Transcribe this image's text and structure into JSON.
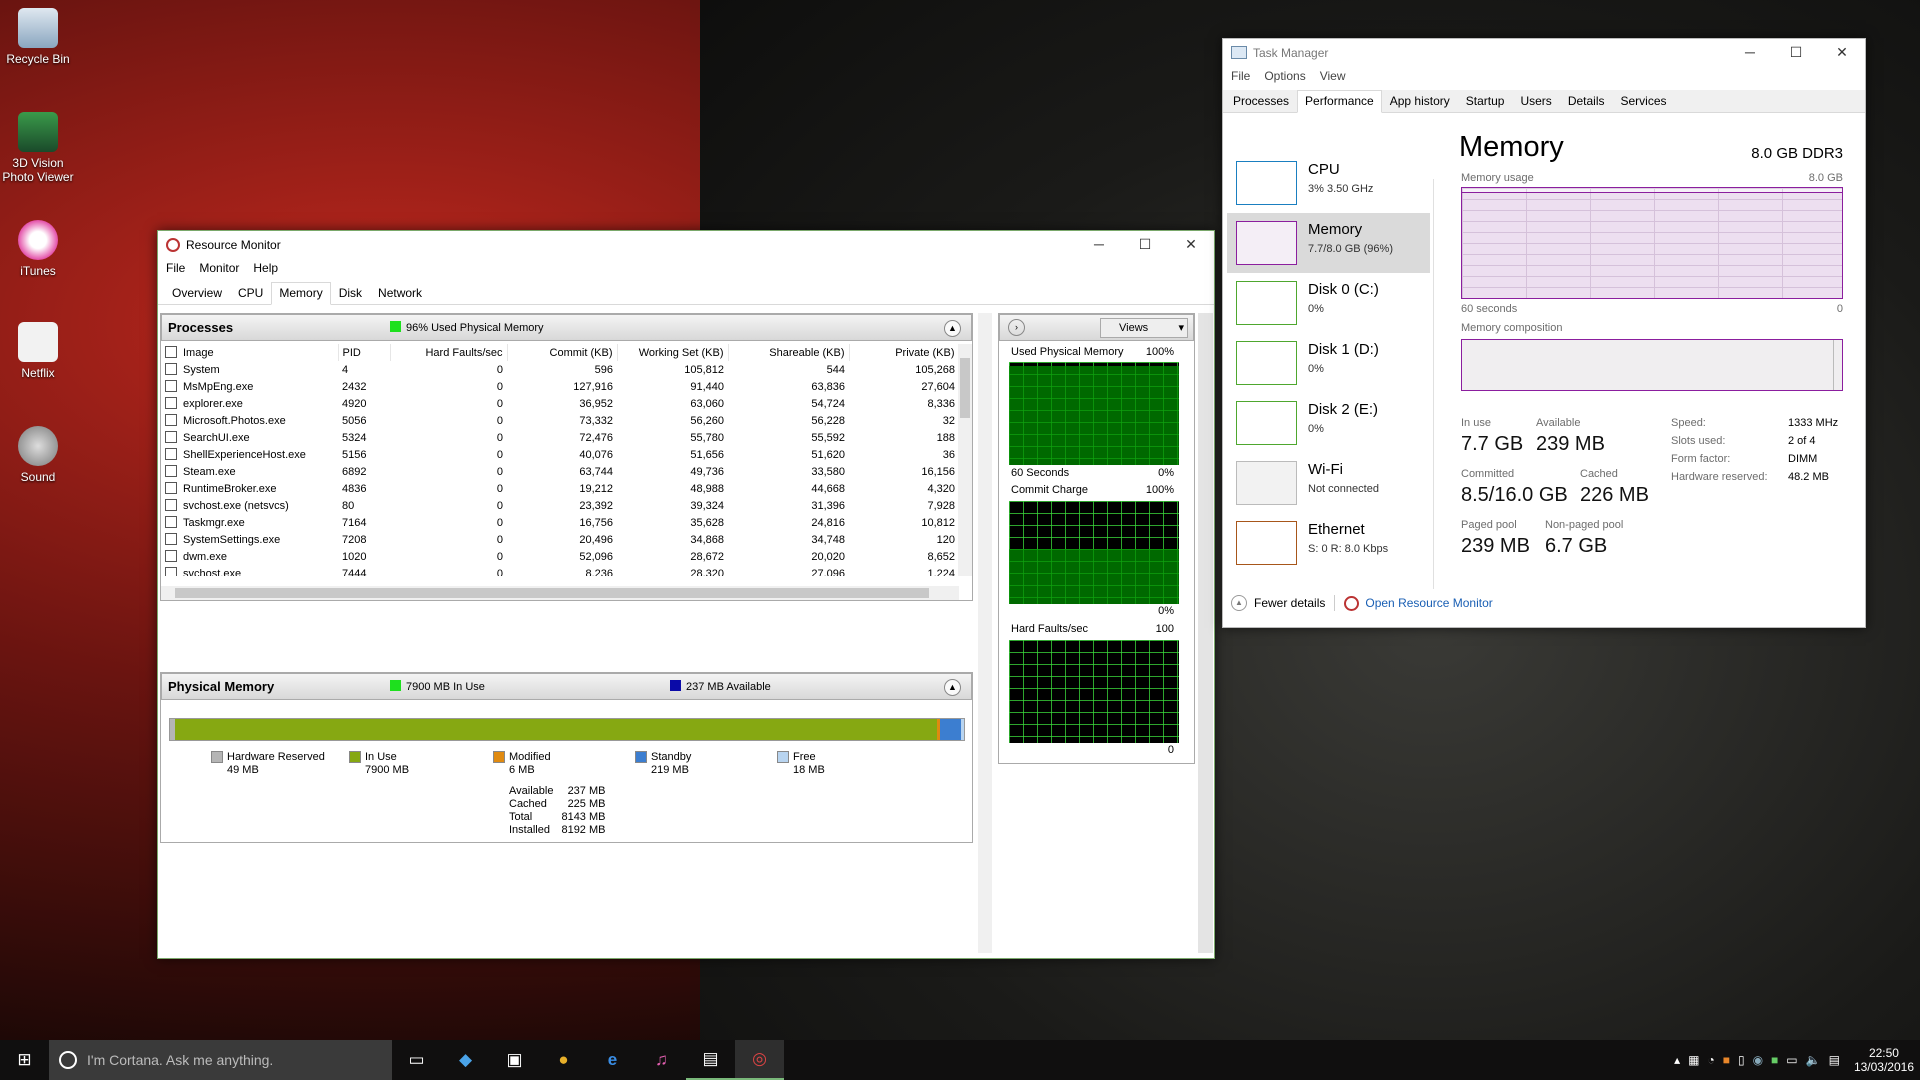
{
  "desktop": {
    "icons": [
      {
        "label": "Recycle Bin",
        "name": "recycle-bin-icon"
      },
      {
        "label": "3D Vision Photo Viewer",
        "name": "3d-vision-icon"
      },
      {
        "label": "iTunes",
        "name": "itunes-icon"
      },
      {
        "label": "Netflix",
        "name": "netflix-icon"
      },
      {
        "label": "Sound",
        "name": "sound-icon"
      }
    ]
  },
  "resmon": {
    "title": "Resource Monitor",
    "menu": [
      "File",
      "Monitor",
      "Help"
    ],
    "tabs": [
      "Overview",
      "CPU",
      "Memory",
      "Disk",
      "Network"
    ],
    "active_tab": "Memory",
    "processes": {
      "title": "Processes",
      "legend": "96% Used Physical Memory",
      "legend_color": "#1ee01e",
      "columns": [
        "Image",
        "PID",
        "Hard Faults/sec",
        "Commit (KB)",
        "Working Set (KB)",
        "Shareable (KB)",
        "Private (KB)"
      ],
      "rows": [
        [
          "System",
          "4",
          "0",
          "596",
          "105,812",
          "544",
          "105,268"
        ],
        [
          "MsMpEng.exe",
          "2432",
          "0",
          "127,916",
          "91,440",
          "63,836",
          "27,604"
        ],
        [
          "explorer.exe",
          "4920",
          "0",
          "36,952",
          "63,060",
          "54,724",
          "8,336"
        ],
        [
          "Microsoft.Photos.exe",
          "5056",
          "0",
          "73,332",
          "56,260",
          "56,228",
          "32"
        ],
        [
          "SearchUI.exe",
          "5324",
          "0",
          "72,476",
          "55,780",
          "55,592",
          "188"
        ],
        [
          "ShellExperienceHost.exe",
          "5156",
          "0",
          "40,076",
          "51,656",
          "51,620",
          "36"
        ],
        [
          "Steam.exe",
          "6892",
          "0",
          "63,744",
          "49,736",
          "33,580",
          "16,156"
        ],
        [
          "RuntimeBroker.exe",
          "4836",
          "0",
          "19,212",
          "48,988",
          "44,668",
          "4,320"
        ],
        [
          "svchost.exe (netsvcs)",
          "80",
          "0",
          "23,392",
          "39,324",
          "31,396",
          "7,928"
        ],
        [
          "Taskmgr.exe",
          "7164",
          "0",
          "16,756",
          "35,628",
          "24,816",
          "10,812"
        ],
        [
          "SystemSettings.exe",
          "7208",
          "0",
          "20,496",
          "34,868",
          "34,748",
          "120"
        ],
        [
          "dwm.exe",
          "1020",
          "0",
          "52,096",
          "28,672",
          "20,020",
          "8,652"
        ],
        [
          "svchost.exe",
          "7444",
          "0",
          "8,236",
          "28,320",
          "27,096",
          "1,224"
        ],
        [
          "perfmon.exe",
          "7400",
          "0",
          "15,408",
          "27,900",
          "14,264",
          "13,636"
        ],
        [
          "SearchIndexer.exe",
          "5124",
          "0",
          "34,628",
          "27,512",
          "20,708",
          "6,804"
        ],
        [
          "steamwebhelper.exe",
          "6320",
          "0",
          "11,440",
          "24,768",
          "24,080",
          "688"
        ],
        [
          "steamwebhelper.exe",
          "7040",
          "0",
          "26,796",
          "24,388",
          "23,860",
          "528"
        ]
      ]
    },
    "physical": {
      "title": "Physical Memory",
      "in_use_legend": "7900 MB In Use",
      "in_use_color": "#1ee01e",
      "available_legend": "237 MB Available",
      "available_color": "#0a0aa8",
      "bar": [
        {
          "label": "Hardware Reserved",
          "value": "49 MB",
          "mb": 49,
          "color": "#b5b5b5"
        },
        {
          "label": "In Use",
          "value": "7900 MB",
          "mb": 7900,
          "color": "#86a812"
        },
        {
          "label": "Modified",
          "value": "6 MB",
          "mb": 6,
          "color": "#e08a10"
        },
        {
          "label": "Standby",
          "value": "219 MB",
          "mb": 219,
          "color": "#3c7ed0"
        },
        {
          "label": "Free",
          "value": "18 MB",
          "mb": 18,
          "color": "#b8d4f0"
        }
      ],
      "stats": [
        [
          "Available",
          "237 MB"
        ],
        [
          "Cached",
          "225 MB"
        ],
        [
          "Total",
          "8143 MB"
        ],
        [
          "Installed",
          "8192 MB"
        ]
      ]
    },
    "graphs": {
      "views_label": "Views",
      "items": [
        {
          "title": "Used Physical Memory",
          "max": "100%",
          "min": "0%",
          "footer": "60 Seconds",
          "level": 0.96
        },
        {
          "title": "Commit Charge",
          "max": "100%",
          "min": "0%",
          "level": 0.53
        },
        {
          "title": "Hard Faults/sec",
          "max": "100",
          "min": "0",
          "level": 0
        }
      ]
    }
  },
  "taskmgr": {
    "title": "Task Manager",
    "menu": [
      "File",
      "Options",
      "View"
    ],
    "tabs": [
      "Processes",
      "Performance",
      "App history",
      "Startup",
      "Users",
      "Details",
      "Services"
    ],
    "active_tab": "Performance",
    "sidebar": [
      {
        "name": "CPU",
        "sub": "3% 3.50 GHz",
        "color": "#1a7fc0"
      },
      {
        "name": "Memory",
        "sub": "7.7/8.0 GB (96%)",
        "color": "#8b1e9e",
        "selected": true
      },
      {
        "name": "Disk 0 (C:)",
        "sub": "0%",
        "color": "#4ea72e"
      },
      {
        "name": "Disk 1 (D:)",
        "sub": "0%",
        "color": "#4ea72e"
      },
      {
        "name": "Disk 2 (E:)",
        "sub": "0%",
        "color": "#4ea72e"
      },
      {
        "name": "Wi-Fi",
        "sub": "Not connected",
        "color": "#bbbbbb"
      },
      {
        "name": "Ethernet",
        "sub": "S: 0 R: 8.0 Kbps",
        "color": "#a7561a"
      }
    ],
    "memory": {
      "title": "Memory",
      "spec": "8.0 GB DDR3",
      "usage_label": "Memory usage",
      "usage_max": "8.0 GB",
      "time_left": "60 seconds",
      "time_right": "0",
      "composition_label": "Memory composition",
      "usage_fraction": 0.96,
      "stats": {
        "in_use_label": "In use",
        "in_use": "7.7 GB",
        "available_label": "Available",
        "available": "239 MB",
        "committed_label": "Committed",
        "committed": "8.5/16.0 GB",
        "cached_label": "Cached",
        "cached": "226 MB",
        "paged_label": "Paged pool",
        "paged": "239 MB",
        "nonpaged_label": "Non-paged pool",
        "nonpaged": "6.7 GB"
      },
      "hw": [
        [
          "Speed:",
          "1333 MHz"
        ],
        [
          "Slots used:",
          "2 of 4"
        ],
        [
          "Form factor:",
          "DIMM"
        ],
        [
          "Hardware reserved:",
          "48.2 MB"
        ]
      ]
    },
    "footer": {
      "fewer": "Fewer details",
      "open": "Open Resource Monitor"
    }
  },
  "taskbar": {
    "search_placeholder": "I'm Cortana. Ask me anything.",
    "time": "22:50",
    "date": "13/03/2016"
  }
}
